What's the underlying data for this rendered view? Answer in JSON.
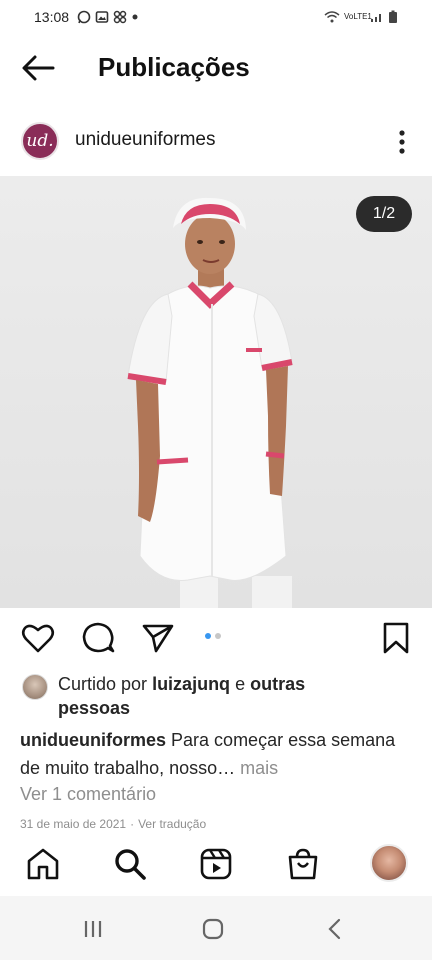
{
  "status_bar": {
    "time": "13:08",
    "icons": [
      "whatsapp-icon",
      "gallery-icon",
      "pinwheel-icon",
      "dot"
    ],
    "network": "VoLTE1",
    "battery": "battery-icon"
  },
  "header": {
    "title": "Publicações"
  },
  "post": {
    "username": "unidueuniformes",
    "brand_avatar_text": "ud.",
    "photo_counter": "1/2",
    "liked_by": {
      "prefix": "Curtido por",
      "user": "luizajunq",
      "conjunction": "e",
      "others": "outras pessoas"
    },
    "caption": {
      "username": "unidueuniformes",
      "text": "Para começar essa semana de muito trabalho, nosso…",
      "more": "mais"
    },
    "comments_link": "Ver 1 comentário",
    "date": "31 de maio de 2021",
    "translate": "Ver tradução"
  },
  "colors": {
    "accent_blue": "#3897f0",
    "brand": "#8a2d58",
    "uniform_trim": "#d94a6e"
  }
}
